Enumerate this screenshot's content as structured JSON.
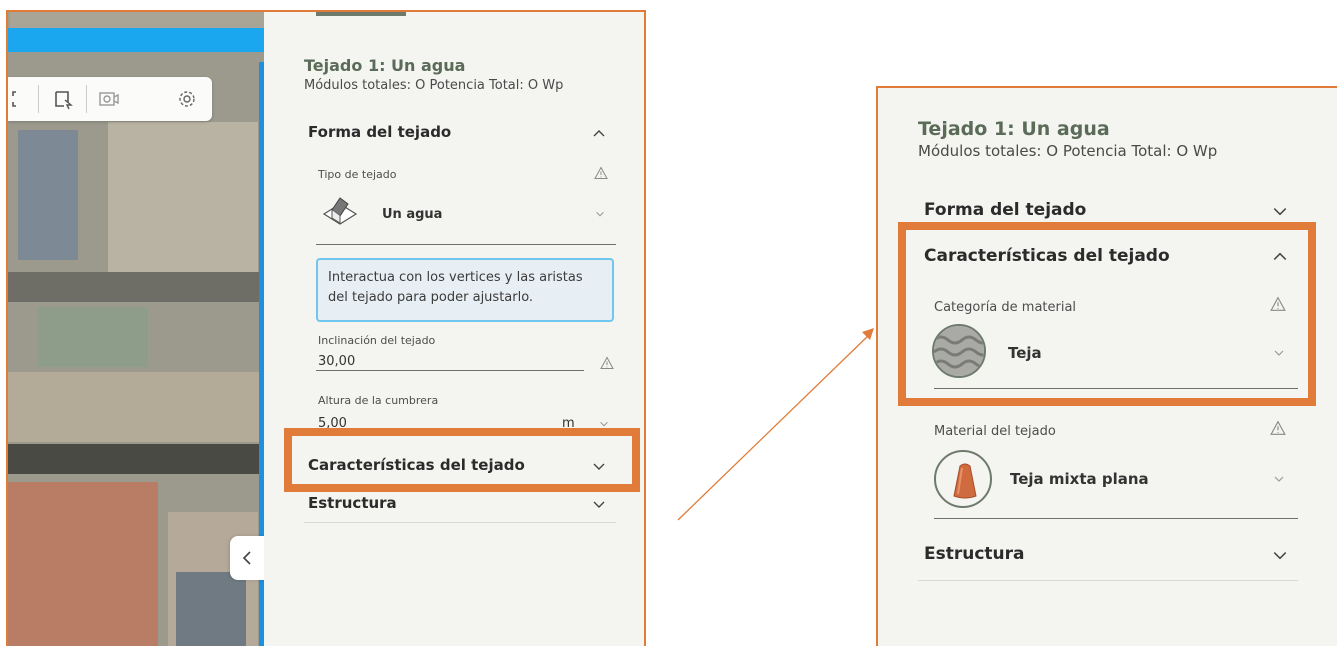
{
  "left_panel": {
    "title": "Tejado 1: Un agua",
    "subtitle": "Módulos totales: O Potencia Total: O Wp",
    "section_shape": "Forma del tejado",
    "roof_type_label": "Tipo de tejado",
    "roof_type_value": "Un agua",
    "info_text": "Interactua con los vertices y las aristas del tejado para poder ajustarlo.",
    "inclination_label": "Inclinación del tejado",
    "inclination_value": "30,00",
    "ridge_label": "Altura de la cumbrera",
    "ridge_value": "5,00",
    "ridge_unit": "m",
    "section_features": "Características del tejado",
    "section_structure": "Estructura"
  },
  "right_panel": {
    "title": "Tejado 1: Un agua",
    "subtitle": "Módulos totales: O Potencia Total: O Wp",
    "section_shape": "Forma del tejado",
    "section_features": "Características del tejado",
    "material_category_label": "Categoría de material",
    "material_category_value": "Teja",
    "roof_material_label": "Material del tejado",
    "roof_material_value": "Teja mixta plana",
    "section_structure": "Estructura"
  },
  "colors": {
    "highlight": "#e07b39",
    "accent_green": "#5a6b58",
    "info_border": "#71c6ee",
    "map_top_bar": "#1ba6f0"
  },
  "icons": [
    "expand-icon",
    "select-roof-icon",
    "camera-icon",
    "gear-icon",
    "chevron-up-icon",
    "chevron-down-icon",
    "warning-icon",
    "house-icon",
    "collapse-left-icon",
    "tile-icon",
    "roof-tile-icon"
  ]
}
